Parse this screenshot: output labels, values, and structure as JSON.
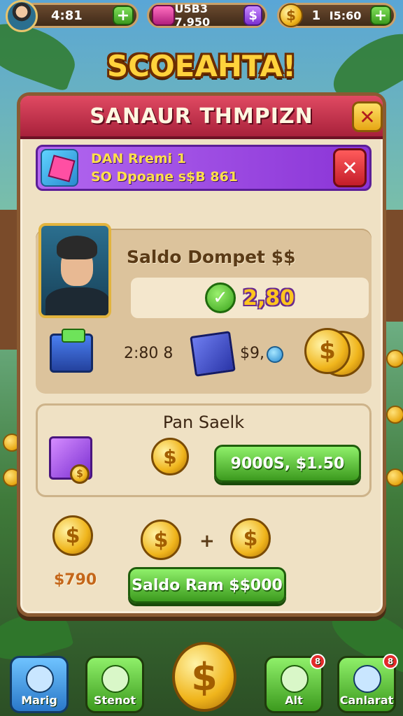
{
  "hud": {
    "player_value": "4:81",
    "player_plus": "+",
    "gems_value": "U5B3 7.950",
    "gems_btn": "$",
    "coin_symbol": "$",
    "coins_value": "1",
    "timer_value": "I5:60",
    "timer_btn": "+"
  },
  "header_title": "SCOEAHTA!",
  "panel": {
    "title": "SANAUR THMPIZN",
    "close_label": "✕"
  },
  "notification": {
    "line1": "DAN Rremi 1",
    "line2": "SO Dpoane s$B 861",
    "close_label": "✕"
  },
  "wallet": {
    "label": "Saldo Dompet $$",
    "check": "✓",
    "balance": "2,80",
    "chest_value": "2:80 8",
    "cube_value": "$9,",
    "coin_symbol": "$"
  },
  "pack": {
    "label": "Pan Saelk",
    "buy_label": "9000S, $1.50",
    "coin_symbol": "$"
  },
  "reward": {
    "coin_symbol": "$",
    "plus": "+",
    "amount": "$790",
    "saldo_label": "Saldo Ram $$000"
  },
  "nav": {
    "items": [
      {
        "label": "Marig"
      },
      {
        "label": "Stenot"
      },
      {
        "label": "Alt",
        "badge": "8"
      },
      {
        "label": "Canlarat",
        "badge": "8"
      }
    ],
    "center_symbol": "$"
  }
}
